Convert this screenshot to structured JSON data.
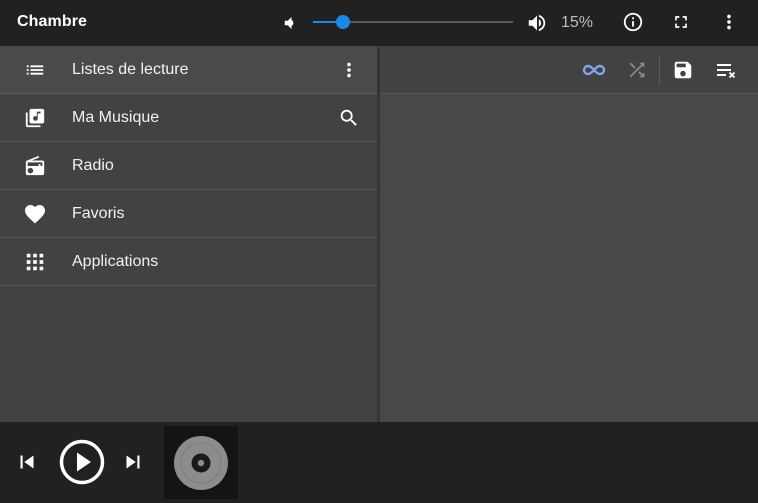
{
  "header": {
    "title": "Chambre",
    "volume_percent": 15,
    "volume_label": "15%"
  },
  "nav": {
    "items": [
      {
        "label": "Listes de lecture",
        "icon": "playlist-icon",
        "right_icon": "more-vert-icon"
      },
      {
        "label": "Ma Musique",
        "icon": "library-music-icon",
        "right_icon": "search-icon"
      },
      {
        "label": "Radio",
        "icon": "radio-icon"
      },
      {
        "label": "Favoris",
        "icon": "heart-icon"
      },
      {
        "label": "Applications",
        "icon": "apps-grid-icon"
      }
    ]
  },
  "queue_toolbar": {
    "repeat_icon": "repeat-all-icon",
    "shuffle_icon": "shuffle-icon",
    "save_icon": "save-icon",
    "clear_icon": "clear-queue-icon"
  },
  "colors": {
    "accent": "#1e88e5",
    "repeat_active": "#7ea7e8",
    "shuffle_inactive": "#8a8a8a",
    "top_bar": "#212121",
    "left_pane": "#424242",
    "right_pane": "#484848"
  }
}
